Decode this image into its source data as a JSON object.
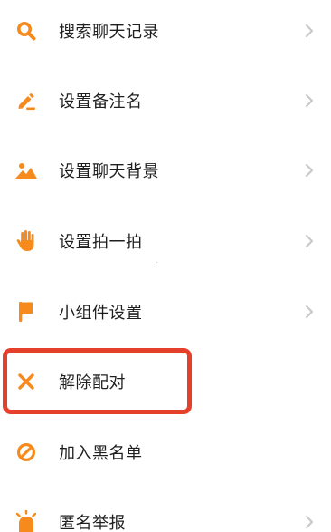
{
  "colors": {
    "accent": "#f78a1c",
    "text": "#1f1f1f",
    "chevron": "#c9c9c9",
    "highlight_box": "#e5402b"
  },
  "menu": {
    "items": [
      {
        "label": "搜索聊天记录",
        "icon": "search-icon",
        "has_chevron": true
      },
      {
        "label": "设置备注名",
        "icon": "pencil-icon",
        "has_chevron": true
      },
      {
        "label": "设置聊天背景",
        "icon": "landscape-icon",
        "has_chevron": true
      },
      {
        "label": "设置拍一拍",
        "icon": "hand-icon",
        "has_chevron": true
      },
      {
        "label": "小组件设置",
        "icon": "flag-icon",
        "has_chevron": true
      },
      {
        "label": "解除配对",
        "icon": "close-icon",
        "has_chevron": false,
        "highlighted": true
      },
      {
        "label": "加入黑名单",
        "icon": "block-icon",
        "has_chevron": false
      },
      {
        "label": "匿名举报",
        "icon": "alarm-icon",
        "has_chevron": true
      }
    ]
  }
}
